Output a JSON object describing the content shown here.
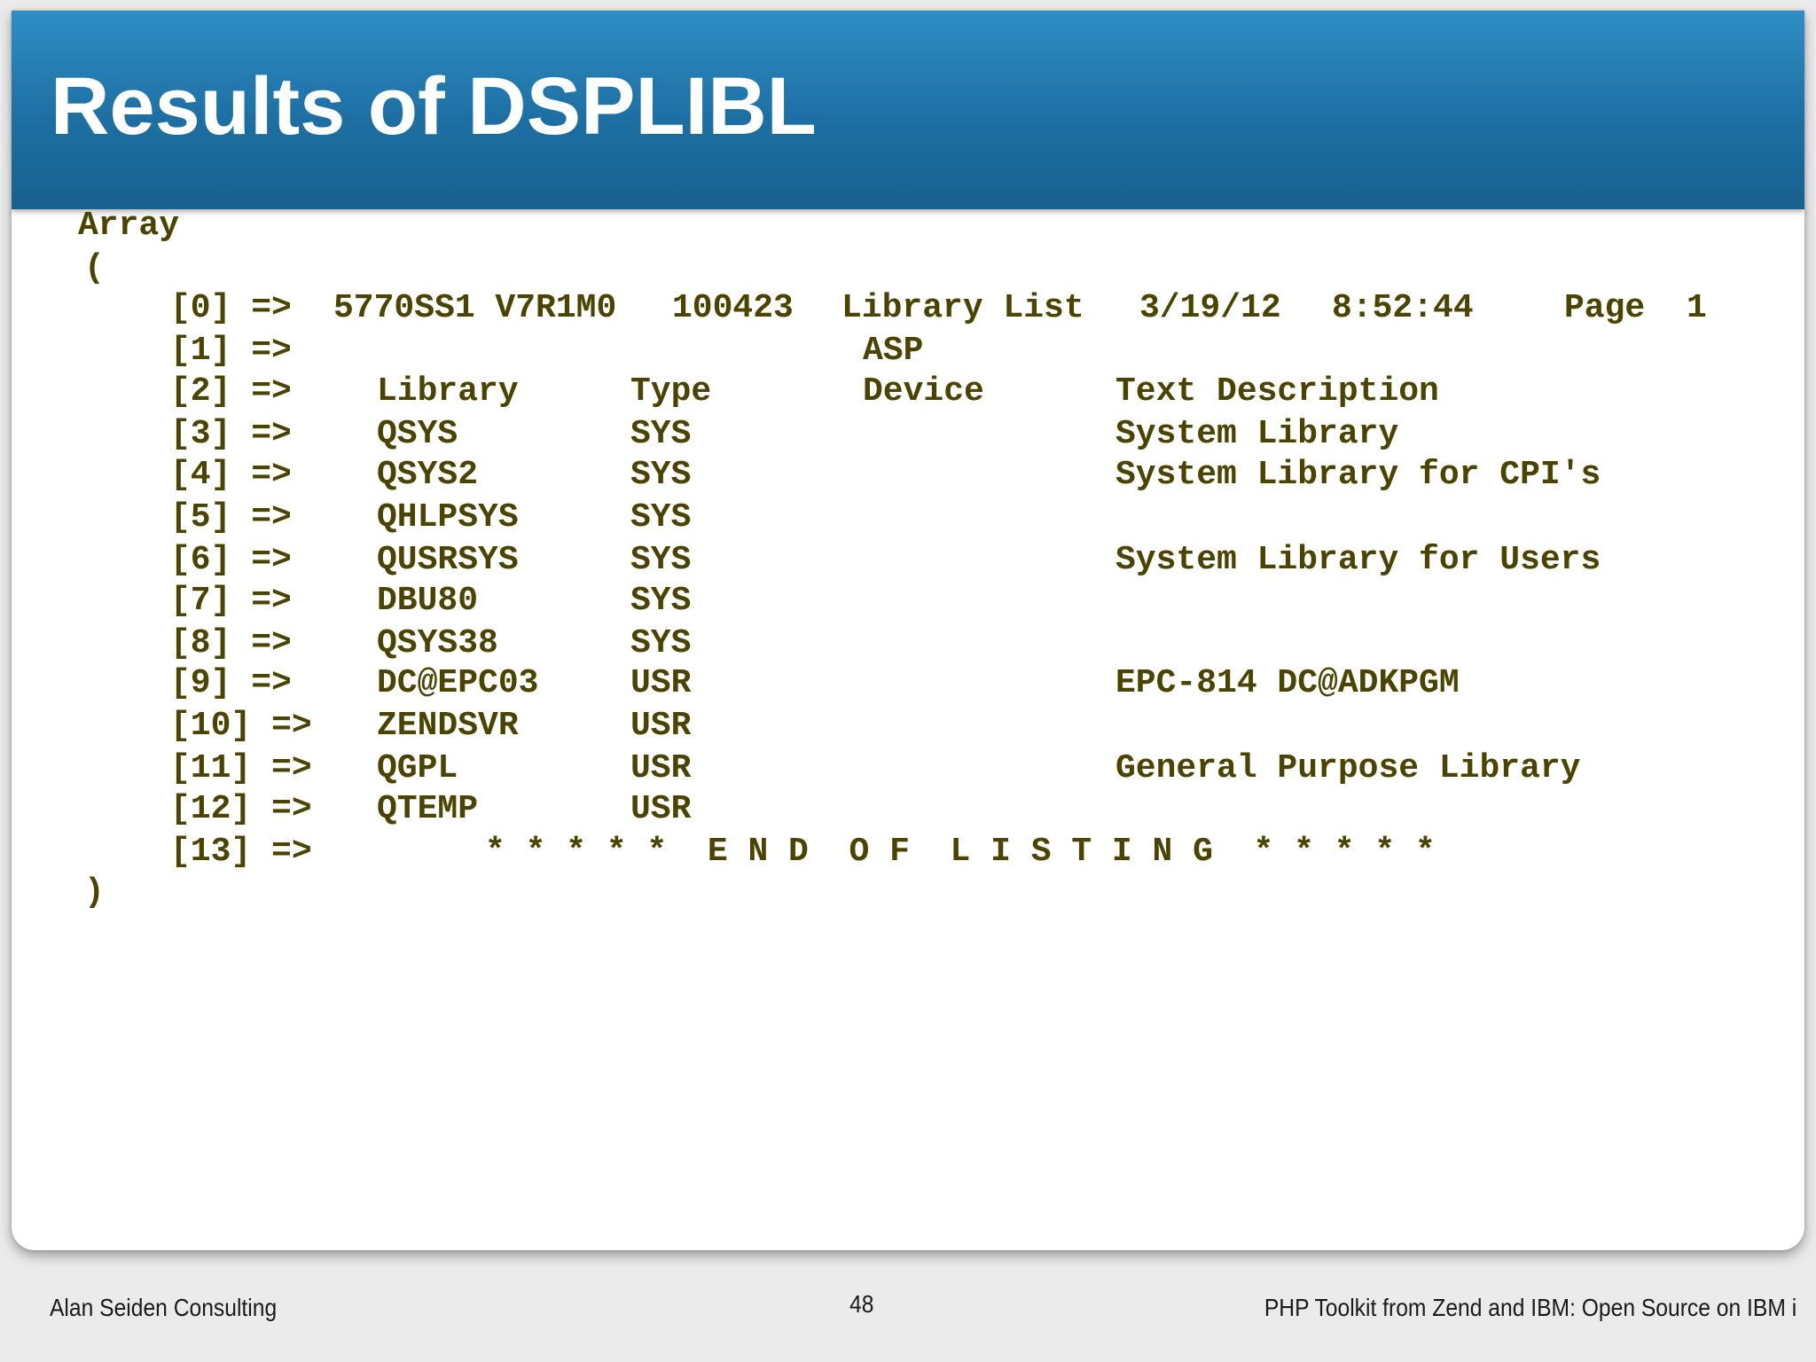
{
  "slide": {
    "title": "Results of DSPLIBL",
    "page_number": "48"
  },
  "footer": {
    "left": "Alan Seiden Consulting",
    "right": "PHP Toolkit from Zend and IBM: Open Source on IBM i"
  },
  "output": {
    "array_open": "Array",
    "paren_open": "(",
    "paren_close": ")",
    "header": {
      "index": "[0] =>",
      "product": "5770SS1 V7R1M0",
      "serial": "100423",
      "report": "Library List",
      "date": "3/19/12",
      "time": "8:52:44",
      "page_label": "Page",
      "page_value": "1"
    },
    "asp_row": {
      "index": "[1] =>",
      "asp": "ASP"
    },
    "columns": {
      "index": "[2] =>",
      "library": "Library",
      "type": "Type",
      "device": "Device",
      "description": "Text Description"
    },
    "rows": [
      {
        "index": "[3] =>",
        "library": "QSYS",
        "type": "SYS",
        "description": "System Library"
      },
      {
        "index": "[4] =>",
        "library": "QSYS2",
        "type": "SYS",
        "description": "System Library for CPI's"
      },
      {
        "index": "[5] =>",
        "library": "QHLPSYS",
        "type": "SYS",
        "description": ""
      },
      {
        "index": "[6] =>",
        "library": "QUSRSYS",
        "type": "SYS",
        "description": "System Library for Users"
      },
      {
        "index": "[7] =>",
        "library": "DBU80",
        "type": "SYS",
        "description": ""
      },
      {
        "index": "[8] =>",
        "library": "QSYS38",
        "type": "SYS",
        "description": ""
      },
      {
        "index": "[9] =>",
        "library": "DC@EPC03",
        "type": "USR",
        "description": "EPC-814 DC@ADKPGM"
      },
      {
        "index": "[10] =>",
        "library": "ZENDSVR",
        "type": "USR",
        "description": ""
      },
      {
        "index": "[11] =>",
        "library": "QGPL",
        "type": "USR",
        "description": "General Purpose Library"
      },
      {
        "index": "[12] =>",
        "library": "QTEMP",
        "type": "USR",
        "description": ""
      }
    ],
    "end_row": {
      "index": "[13] =>",
      "text": "* * * * *  E N D  O F  L I S T I N G  * * * * *"
    }
  }
}
